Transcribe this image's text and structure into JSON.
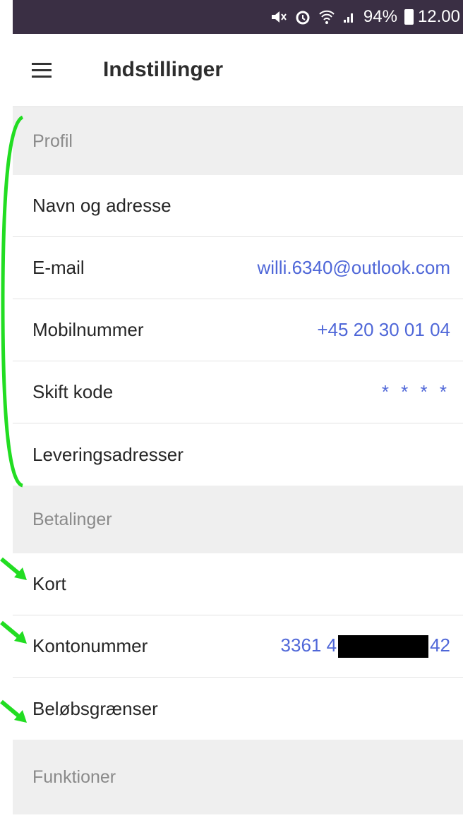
{
  "status_bar": {
    "icons": [
      "mute-icon",
      "alarm-icon",
      "wifi-icon",
      "signal-icon"
    ],
    "battery_percent": "94%",
    "time": "12.00"
  },
  "app_bar": {
    "menu_icon": "hamburger-menu-icon",
    "title": "Indstillinger"
  },
  "sections": {
    "profile": {
      "header": "Profil",
      "rows": {
        "name_address": {
          "label": "Navn og adresse"
        },
        "email": {
          "label": "E-mail",
          "value": "willi.6340@outlook.com"
        },
        "mobile": {
          "label": "Mobilnummer",
          "value": "+45 20 30 01 04"
        },
        "change_code": {
          "label": "Skift kode",
          "value": "* * * *"
        },
        "delivery_addresses": {
          "label": "Leveringsadresser"
        }
      }
    },
    "payments": {
      "header": "Betalinger",
      "rows": {
        "card": {
          "label": "Kort"
        },
        "account_number": {
          "label": "Kontonummer",
          "value_prefix": "3361 4",
          "value_suffix": "42"
        },
        "amount_limits": {
          "label": "Beløbsgrænser"
        }
      }
    },
    "functions": {
      "header": "Funktioner"
    }
  },
  "colors": {
    "status_bar_bg": "#3a2f44",
    "link_blue": "#4f67d8",
    "section_bg": "#efefef",
    "annotation_green": "#22dd22"
  }
}
